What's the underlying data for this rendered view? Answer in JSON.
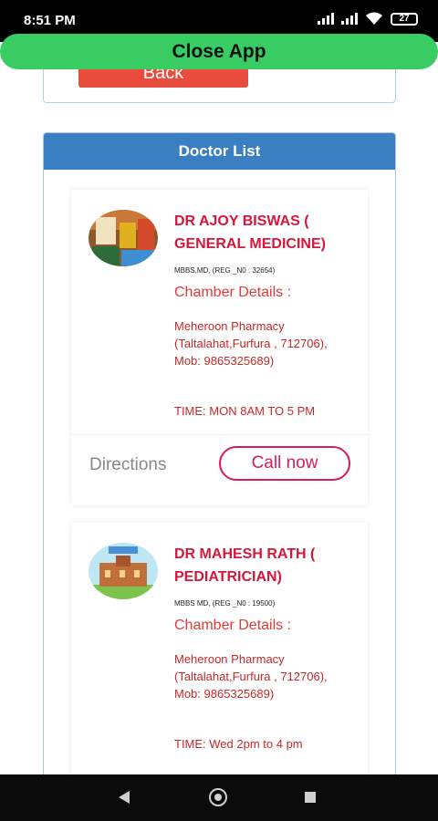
{
  "status_bar": {
    "time": "8:51 PM",
    "battery": "27"
  },
  "overlay": {
    "close_app_label": "Close App"
  },
  "top_section": {
    "back_label": "Back"
  },
  "doctor_panel": {
    "title": "Doctor List",
    "doctors": [
      {
        "name": "DR AJOY BISWAS ( GENERAL MEDICINE)",
        "qualification": "MBBS,MD, (REG _N0 : 32654)",
        "chamber_title": "Chamber Details :",
        "address": "Meheroon Pharmacy (Taltalahat,Furfura , 712706), Mob: 9865325689)",
        "time": "TIME: MON 8AM TO 5 PM",
        "directions_label": "Directions",
        "call_label": "Call now"
      },
      {
        "name": "DR MAHESH RATH ( PEDIATRICIAN)",
        "qualification": "MBBS MD, (REG _N0 : 19500)",
        "chamber_title": "Chamber Details :",
        "address": "Meheroon Pharmacy (Taltalahat,Furfura , 712706), Mob: 9865325689)",
        "time": "TIME: Wed 2pm to 4 pm"
      }
    ]
  },
  "nav_bar": {
    "icons": [
      "back-icon",
      "home-icon",
      "recents-icon"
    ]
  }
}
